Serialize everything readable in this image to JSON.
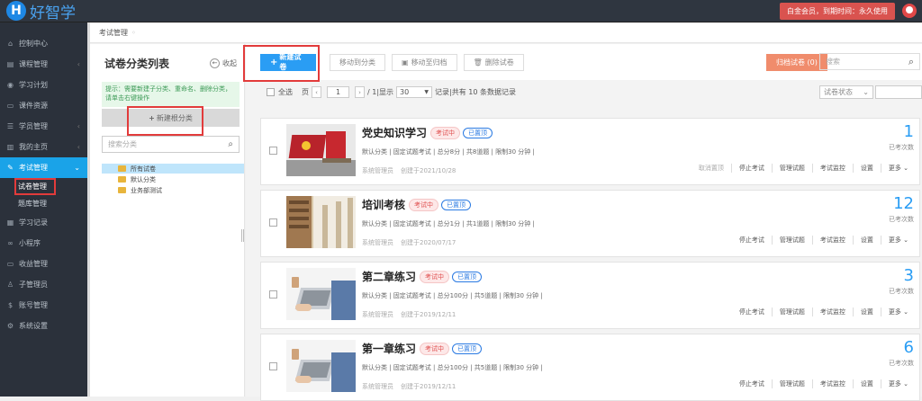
{
  "app": {
    "logo_letter": "H",
    "logo_name": "好智学"
  },
  "topbar": {
    "vip_text": "白金会员，到期时间：永久使用"
  },
  "sidebar": {
    "items": [
      {
        "label": "控制中心",
        "icon": "dashboard-icon",
        "glyph": "⌂",
        "arrow": ""
      },
      {
        "label": "课程管理",
        "icon": "course-icon",
        "glyph": "▤",
        "arrow": "‹"
      },
      {
        "label": "学习计划",
        "icon": "plan-icon",
        "glyph": "◉",
        "arrow": ""
      },
      {
        "label": "课件资源",
        "icon": "resource-icon",
        "glyph": "▭",
        "arrow": ""
      },
      {
        "label": "学员管理",
        "icon": "student-icon",
        "glyph": "☰",
        "arrow": "‹"
      },
      {
        "label": "我的主页",
        "icon": "home-icon",
        "glyph": "▥",
        "arrow": "‹"
      },
      {
        "label": "考试管理",
        "icon": "exam-icon",
        "glyph": "✎",
        "arrow": "⌄"
      }
    ],
    "sub_items": [
      {
        "label": "试卷管理"
      },
      {
        "label": "题库管理"
      }
    ],
    "items_after": [
      {
        "label": "学习记录",
        "icon": "record-icon",
        "glyph": "▦"
      },
      {
        "label": "小程序",
        "icon": "miniapp-icon",
        "glyph": "∞"
      },
      {
        "label": "收益管理",
        "icon": "income-icon",
        "glyph": "▭"
      },
      {
        "label": "子管理员",
        "icon": "subadmin-icon",
        "glyph": "♙"
      },
      {
        "label": "账号管理",
        "icon": "account-icon",
        "glyph": "$"
      },
      {
        "label": "系统设置",
        "icon": "settings-icon",
        "glyph": "⚙"
      }
    ]
  },
  "breadcrumb": {
    "label": "考试管理",
    "dot": "◦"
  },
  "left_panel": {
    "title": "试卷分类列表",
    "collapse_label": "收起",
    "tip": "提示：需要新建子分类、重命名、删除分类，请单击右键操作",
    "new_root_label": "新建根分类",
    "search_placeholder": "搜索分类",
    "tree": [
      "所有试卷",
      "默认分类",
      "业务部测试"
    ]
  },
  "toolbar": {
    "new_exam": "新建试卷",
    "move_category": "移动到分类",
    "move_archive": "移动至归档",
    "delete_exam": "删除试卷",
    "archive_label": "归档试卷 (0)",
    "search_placeholder": "搜索"
  },
  "pager": {
    "select_all": "全选",
    "page_label": "页",
    "page_value": "1",
    "page_total": "/ 1|显示",
    "page_size": "30",
    "summary": "记录|共有 10 条数据记录",
    "status_filter": "试卷状态"
  },
  "exams": [
    {
      "title": "党史知识学习",
      "status": "考试中",
      "pin": "已置顶",
      "meta": "默认分类 | 固定试题考试 | 总分8分 | 共8道题 | 限制30 分钟 |",
      "author": "系统管理员",
      "created": "创建于2021/10/28",
      "count": "1",
      "count_label": "已考次数",
      "actions": [
        "取消置顶",
        "停止考试",
        "管理试题",
        "考试监控",
        "设置",
        "更多 ⌄"
      ]
    },
    {
      "title": "培训考核",
      "status": "考试中",
      "pin": "已置顶",
      "meta": "默认分类 | 固定试题考试 | 总分1分 | 共1道题 | 限制30 分钟 |",
      "author": "系统管理员",
      "created": "创建于2020/07/17",
      "count": "12",
      "count_label": "已考次数",
      "actions": [
        "停止考试",
        "管理试题",
        "考试监控",
        "设置",
        "更多 ⌄"
      ]
    },
    {
      "title": "第二章练习",
      "status": "考试中",
      "pin": "已置顶",
      "meta": "默认分类 | 固定试题考试 | 总分100分 | 共5道题 | 限制30 分钟 |",
      "author": "系统管理员",
      "created": "创建于2019/12/11",
      "count": "3",
      "count_label": "已考次数",
      "actions": [
        "停止考试",
        "管理试题",
        "考试监控",
        "设置",
        "更多 ⌄"
      ]
    },
    {
      "title": "第一章练习",
      "status": "考试中",
      "pin": "已置顶",
      "meta": "默认分类 | 固定试题考试 | 总分100分 | 共5道题 | 限制30 分钟 |",
      "author": "系统管理员",
      "created": "创建于2019/12/11",
      "count": "6",
      "count_label": "已考次数",
      "actions": [
        "停止考试",
        "管理试题",
        "考试监控",
        "设置",
        "更多 ⌄"
      ]
    }
  ]
}
